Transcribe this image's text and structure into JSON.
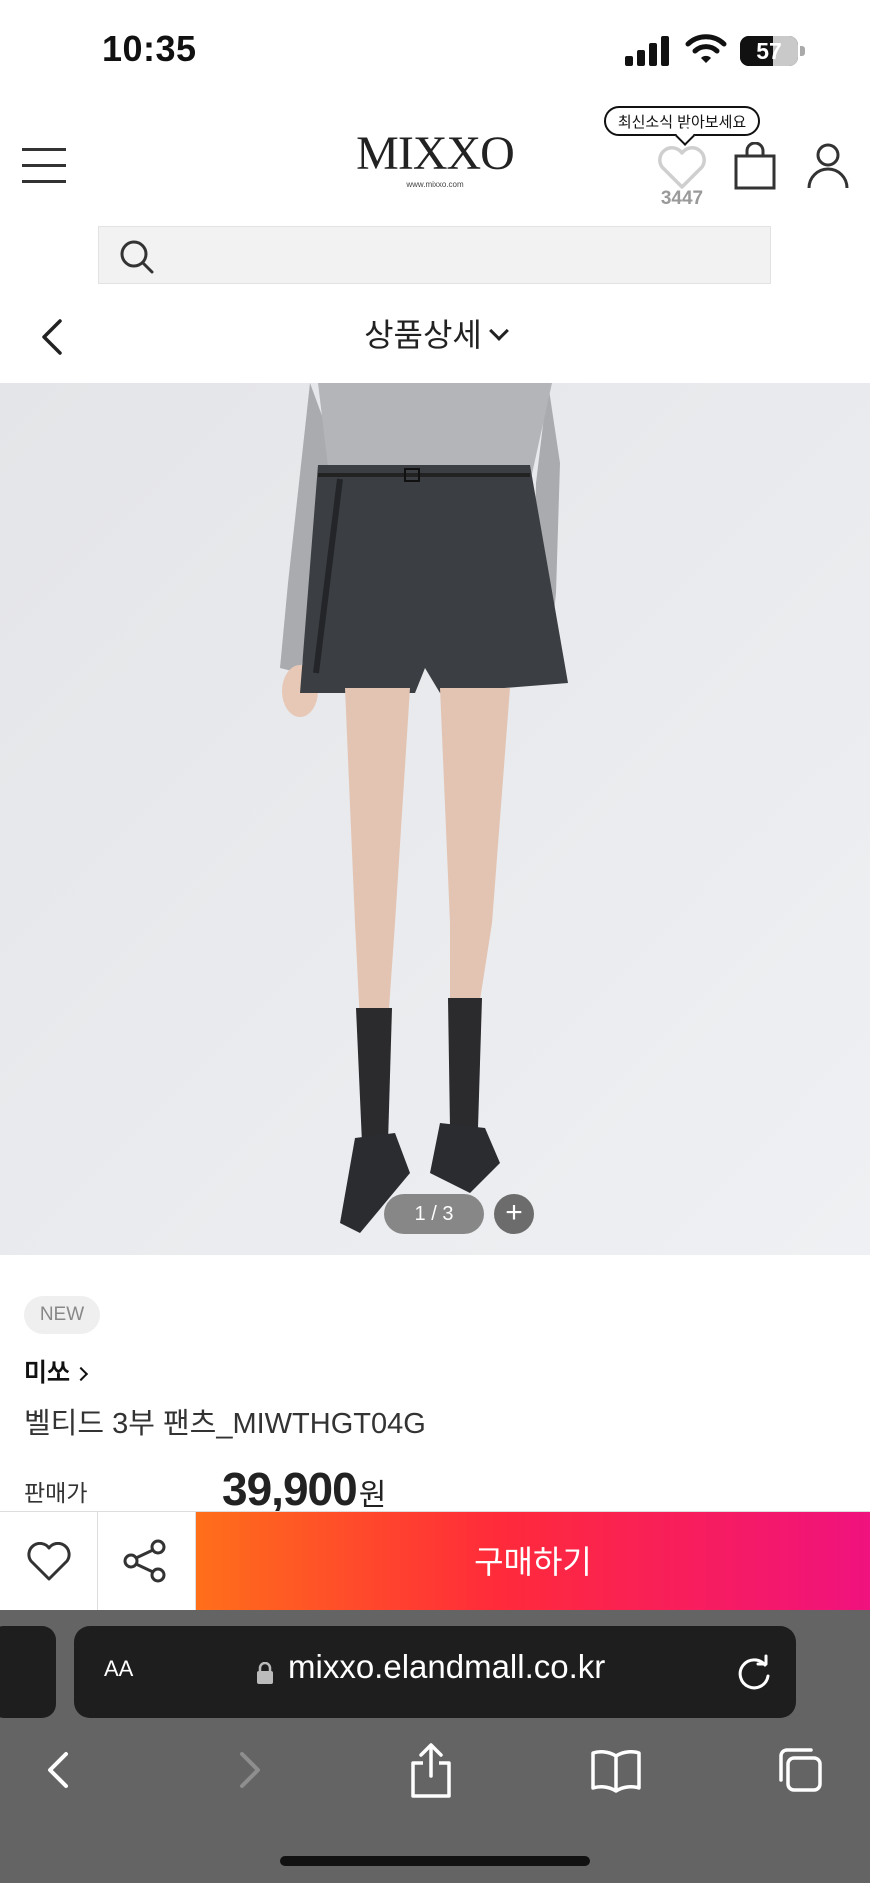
{
  "status_bar": {
    "time": "10:35",
    "battery": "57",
    "battery_level": 0.57
  },
  "header": {
    "logo": "MIXXO",
    "logo_sub": "www.mixxo.com",
    "tooltip": "최신소식 받아보세요",
    "wish_count": "3447"
  },
  "search": {
    "placeholder": ""
  },
  "subnav": {
    "title": "상품상세"
  },
  "gallery": {
    "counter": "1 / 3",
    "current": 1,
    "total": 3,
    "zoom_label": "+"
  },
  "product": {
    "badge": "NEW",
    "brand": "미쏘",
    "name": "벨티드 3부 팬츠_MIWTHGT04G",
    "price_label": "판매가",
    "price": "39,900",
    "price_unit": "원"
  },
  "actions": {
    "buy_label": "구매하기"
  },
  "browser": {
    "aa": "AA",
    "url": "mixxo.elandmall.co.kr"
  },
  "colors": {
    "buy_gradient_start": "#ff6f1a",
    "buy_gradient_end": "#f0127e",
    "browser_chrome": "#646464"
  }
}
